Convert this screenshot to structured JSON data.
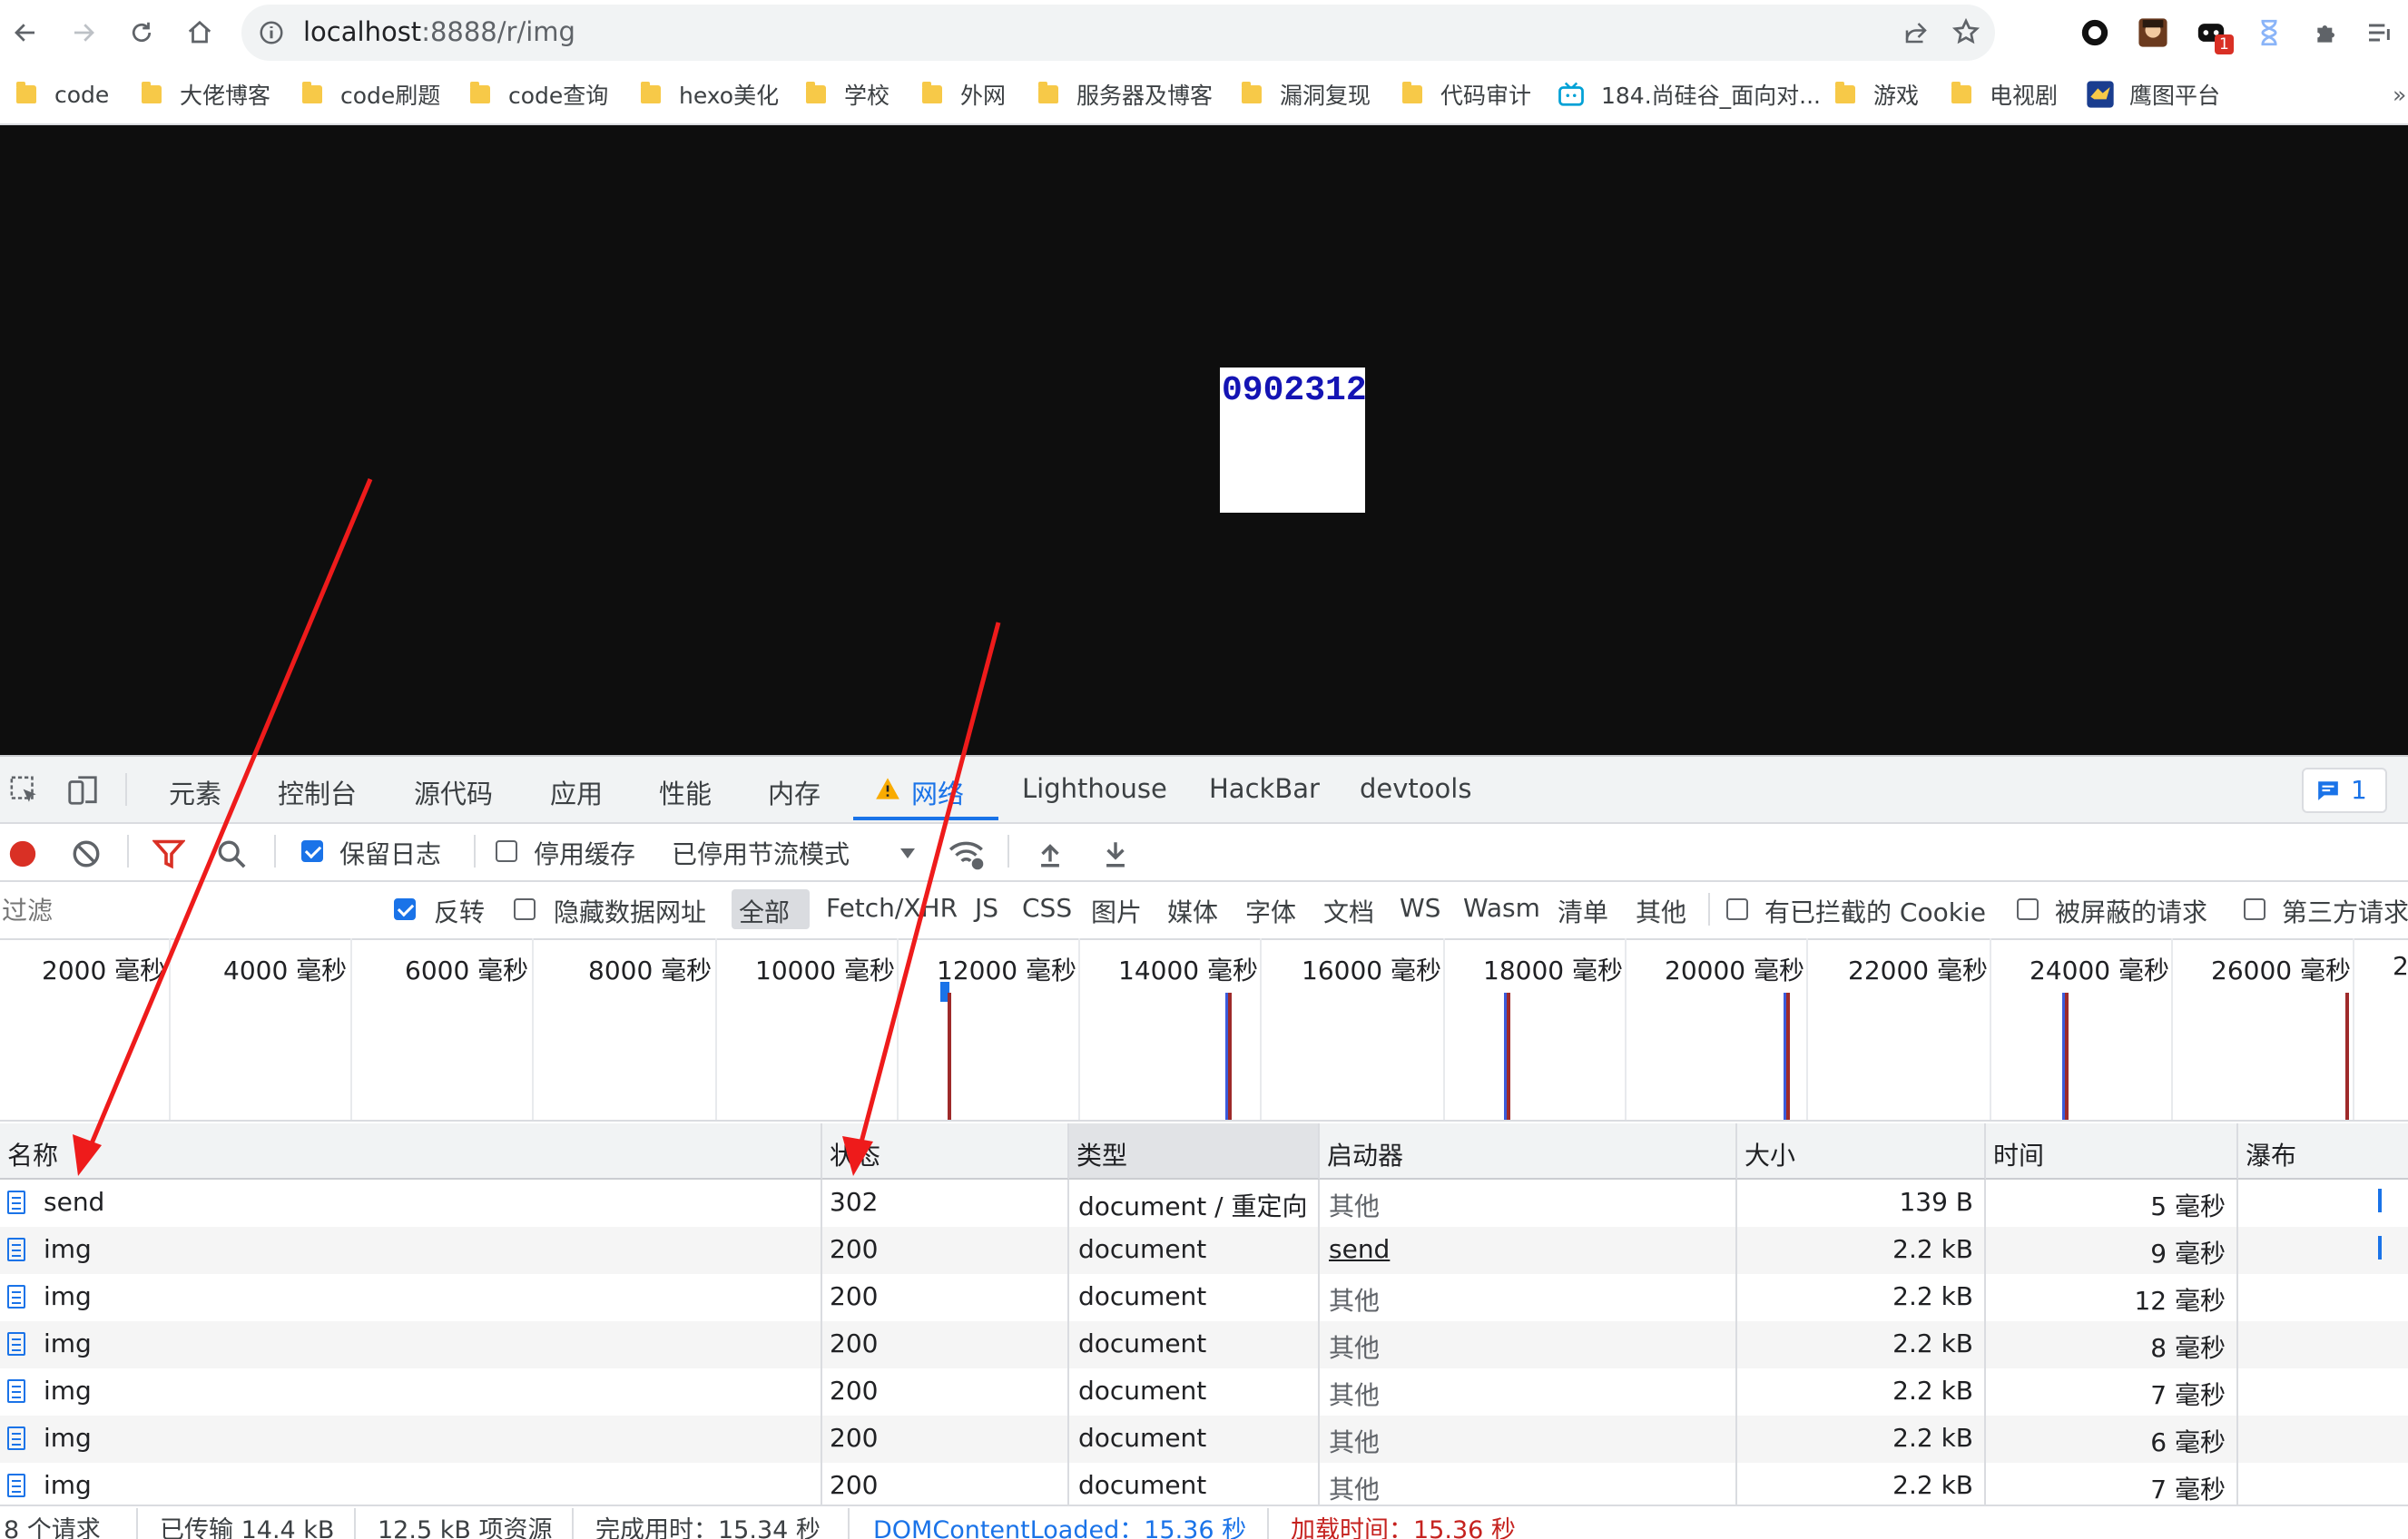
{
  "browser": {
    "url_host": "localhost",
    "url_rest": ":8888/r/img",
    "bookmarks": [
      "code",
      "大佬博客",
      "code刷题",
      "code查询",
      "hexo美化",
      "学校",
      "外网",
      "服务器及博客",
      "漏洞复现",
      "代码审计",
      "184.尚硅谷_面向对...",
      "游戏",
      "电视剧",
      "鹰图平台"
    ],
    "ext_badge": "1"
  },
  "page": {
    "captcha_text": "0902312"
  },
  "devtools": {
    "tabs": [
      "元素",
      "控制台",
      "源代码",
      "应用",
      "性能",
      "内存",
      "网络",
      "Lighthouse",
      "HackBar",
      "devtools"
    ],
    "issues_count": "1",
    "toolbar": {
      "preserve_log": "保留日志",
      "disable_cache": "停用缓存",
      "throttling": "已停用节流模式"
    },
    "filter": {
      "placeholder": "过滤",
      "invert": "反转",
      "hide_data_urls": "隐藏数据网址",
      "types": [
        "全部",
        "Fetch/XHR",
        "JS",
        "CSS",
        "图片",
        "媒体",
        "字体",
        "文档",
        "WS",
        "Wasm",
        "清单",
        "其他"
      ],
      "blocked_cookies": "有已拦截的 Cookie",
      "blocked_requests": "被屏蔽的请求",
      "third_party": "第三方请求"
    },
    "overview_ticks": [
      "2000 毫秒",
      "4000 毫秒",
      "6000 毫秒",
      "8000 毫秒",
      "10000 毫秒",
      "12000 毫秒",
      "14000 毫秒",
      "16000 毫秒",
      "18000 毫秒",
      "20000 毫秒",
      "22000 毫秒",
      "24000 毫秒",
      "26000 毫秒",
      "2"
    ],
    "columns": [
      "名称",
      "状态",
      "类型",
      "启动器",
      "大小",
      "时间",
      "瀑布"
    ],
    "rows": [
      {
        "name": "send",
        "status": "302",
        "type": "document / 重定向",
        "initiator": "其他",
        "size": "139 B",
        "time": "5 毫秒"
      },
      {
        "name": "img",
        "status": "200",
        "type": "document",
        "initiator": "send",
        "size": "2.2 kB",
        "time": "9 毫秒"
      },
      {
        "name": "img",
        "status": "200",
        "type": "document",
        "initiator": "其他",
        "size": "2.2 kB",
        "time": "12 毫秒"
      },
      {
        "name": "img",
        "status": "200",
        "type": "document",
        "initiator": "其他",
        "size": "2.2 kB",
        "time": "8 毫秒"
      },
      {
        "name": "img",
        "status": "200",
        "type": "document",
        "initiator": "其他",
        "size": "2.2 kB",
        "time": "7 毫秒"
      },
      {
        "name": "img",
        "status": "200",
        "type": "document",
        "initiator": "其他",
        "size": "2.2 kB",
        "time": "6 毫秒"
      },
      {
        "name": "img",
        "status": "200",
        "type": "document",
        "initiator": "其他",
        "size": "2.2 kB",
        "time": "7 毫秒"
      }
    ],
    "status_bar": {
      "requests": "8 个请求",
      "transferred": "已传输 14.4 kB",
      "resources": "12.5 kB 项资源",
      "finish": "完成用时：15.34 秒",
      "dcl": "DOMContentLoaded：15.36 秒",
      "load": "加载时间：15.36 秒"
    }
  }
}
